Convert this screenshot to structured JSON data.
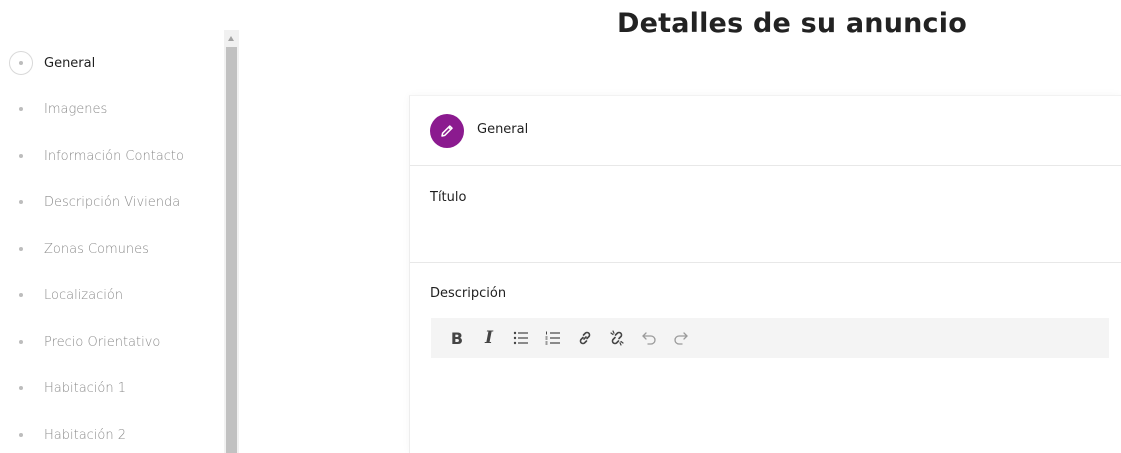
{
  "page": {
    "title": "Detalles de su anuncio"
  },
  "sidebar": {
    "items": [
      {
        "label": "General",
        "active": true
      },
      {
        "label": "Imagenes",
        "active": false
      },
      {
        "label": "Información Contacto",
        "active": false
      },
      {
        "label": "Descripción Vivienda",
        "active": false
      },
      {
        "label": "Zonas Comunes",
        "active": false
      },
      {
        "label": "Localización",
        "active": false
      },
      {
        "label": "Precio Orientativo",
        "active": false
      },
      {
        "label": "Habitación 1",
        "active": false
      },
      {
        "label": "Habitación 2",
        "active": false
      }
    ]
  },
  "card": {
    "header_title": "General",
    "header_icon": "pencil-icon",
    "fields": {
      "title_label": "Título",
      "description_label": "Descripción"
    },
    "toolbar": {
      "buttons": [
        {
          "name": "bold",
          "glyph": "B"
        },
        {
          "name": "italic",
          "glyph": "I"
        },
        {
          "name": "bullet-list-icon"
        },
        {
          "name": "numbered-list-icon"
        },
        {
          "name": "link-icon"
        },
        {
          "name": "unlink-icon"
        },
        {
          "name": "undo-icon"
        },
        {
          "name": "redo-icon"
        }
      ]
    }
  },
  "colors": {
    "accent": "#8b1a8f",
    "active_text": "#1f1f1f",
    "inactive_text": "#8a8a8a"
  }
}
